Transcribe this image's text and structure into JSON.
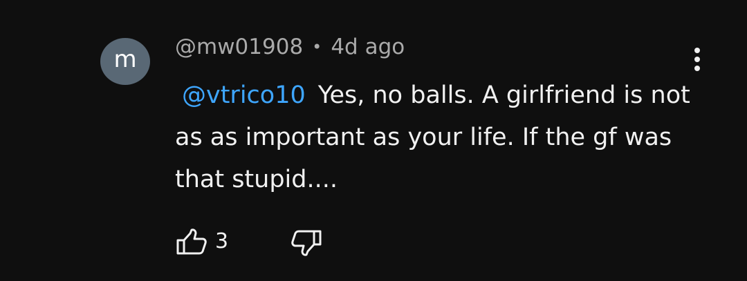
{
  "comment": {
    "avatar_letter": "m",
    "avatar_color": "#596875",
    "author": "@mw01908",
    "separator": "•",
    "time": "4d ago",
    "mention": "@vtrico10",
    "text": "Yes, no balls. A girlfriend is not as as important as your life. If the gf was that stupid....",
    "mention_color": "#3ea6ff"
  },
  "actions": {
    "like_count": "3",
    "like_icon": "thumbs-up-icon",
    "dislike_icon": "thumbs-down-icon",
    "more_icon": "more-vertical-icon"
  }
}
